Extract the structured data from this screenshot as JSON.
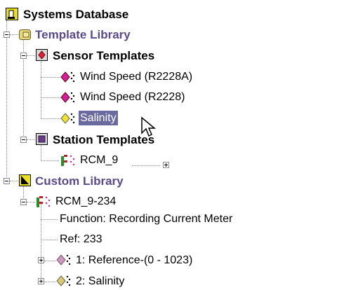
{
  "tree": {
    "root": {
      "label": "Systems Database",
      "icon": "database-icon"
    },
    "template_library": {
      "label": "Template Library",
      "icon": "library-icon",
      "sensor_templates": {
        "label": "Sensor Templates",
        "icon": "sensor-folder-icon",
        "items": [
          {
            "label": "Wind Speed (R2228A)",
            "icon": "sensor-icon"
          },
          {
            "label": "Wind Speed (R2228)",
            "icon": "sensor-icon"
          },
          {
            "label": "Salinity",
            "icon": "sensor-icon",
            "selected": true
          }
        ]
      },
      "station_templates": {
        "label": "Station Templates",
        "icon": "station-folder-icon",
        "items": [
          {
            "label": "RCM_9",
            "icon": "station-icon"
          }
        ]
      }
    },
    "custom_library": {
      "label": "Custom Library",
      "icon": "custom-library-icon",
      "station": {
        "label": "RCM_9-234",
        "icon": "station-icon",
        "function": "Function: Recording Current Meter",
        "ref": "Ref: 233",
        "sensors": [
          {
            "label": "1: Reference-(0 - 1023)",
            "icon": "sensor-icon"
          },
          {
            "label": "2: Salinity",
            "icon": "sensor-icon"
          }
        ]
      }
    }
  },
  "colors": {
    "selection": "#6a6aa0",
    "library_text": "#5a4a8a",
    "tree_lines": "#8a8a8a"
  }
}
